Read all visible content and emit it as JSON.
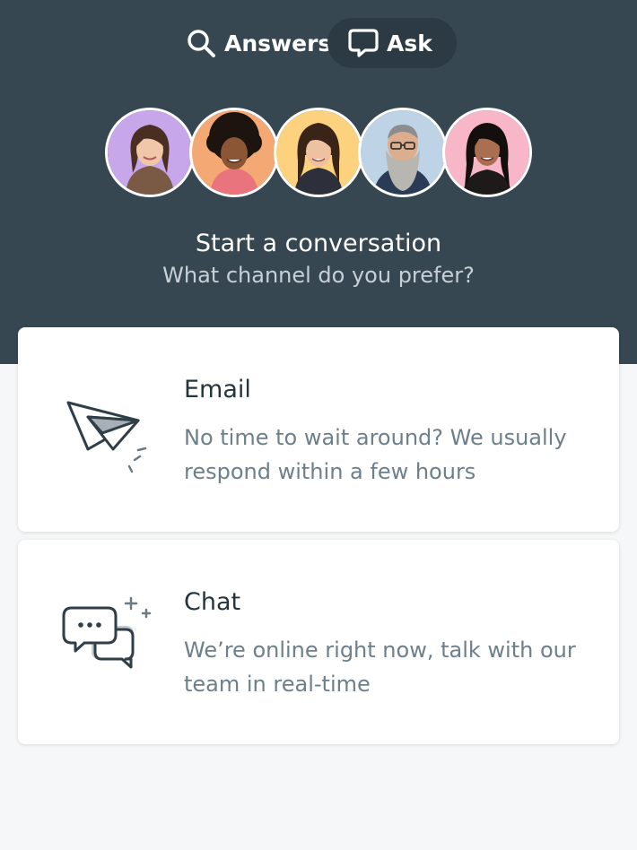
{
  "tabs": [
    {
      "label": "Answers",
      "icon": "search-icon",
      "active": false
    },
    {
      "label": "Ask",
      "icon": "speech-bubble-icon",
      "active": true
    }
  ],
  "avatars": [
    {
      "bg": "#c8a6ea"
    },
    {
      "bg": "#f4a874"
    },
    {
      "bg": "#fcd27e"
    },
    {
      "bg": "#bfd3e6"
    },
    {
      "bg": "#f8b7c9"
    }
  ],
  "header": {
    "title": "Start a conversation",
    "subtitle": "What channel do you prefer?"
  },
  "channels": {
    "email": {
      "title": "Email",
      "description": "No time to wait around? We usually respond within a few hours",
      "icon": "paper-plane-icon"
    },
    "chat": {
      "title": "Chat",
      "description": "We’re online right now, talk with our team in real-time",
      "icon": "chat-bubbles-icon"
    }
  },
  "colors": {
    "header_bg": "#364751",
    "active_tab_bg": "#2b3a43",
    "page_bg": "#f6f7f8",
    "title_text": "#26343c",
    "desc_text": "#6d7f8a"
  }
}
